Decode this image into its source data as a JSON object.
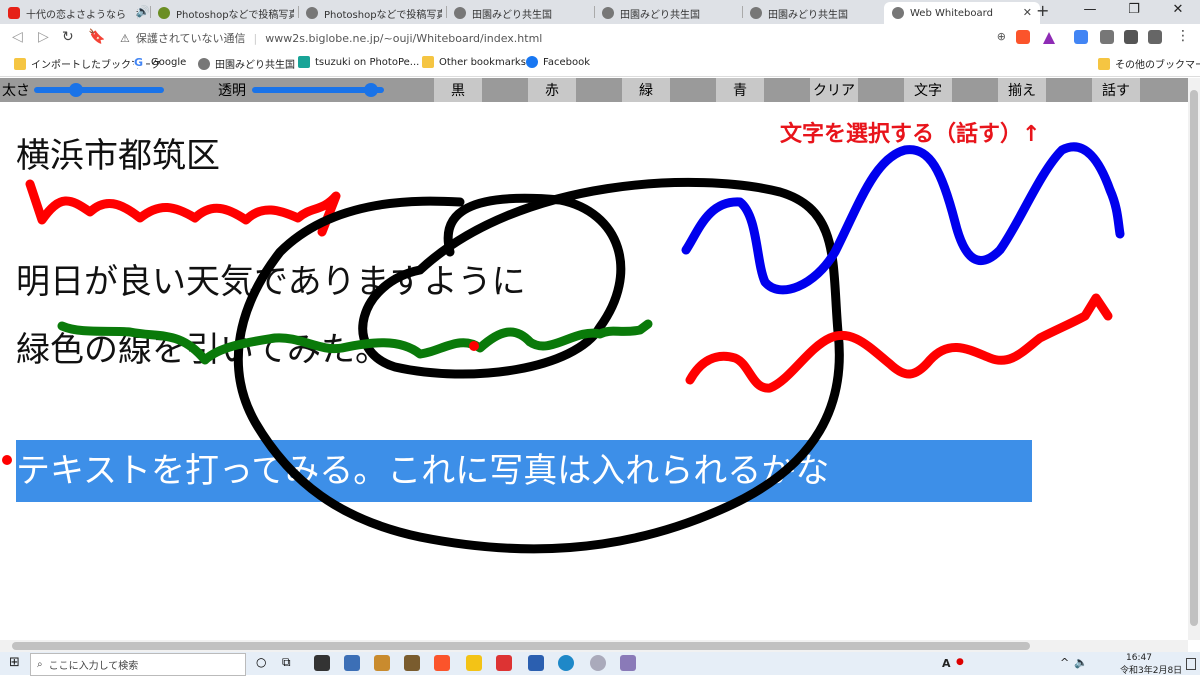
{
  "browser": {
    "tabs": [
      {
        "title": "十代の恋よさようなら　神…",
        "icon": "youtube-icon"
      },
      {
        "title": "Photoshopなどで投稿写真や…",
        "icon": "photo-icon"
      },
      {
        "title": "Photoshopなどで投稿写真や…",
        "icon": "globe-icon"
      },
      {
        "title": "田園みどり共生国",
        "icon": "globe-icon"
      },
      {
        "title": "田園みどり共生国",
        "icon": "globe-icon"
      },
      {
        "title": "田園みどり共生国",
        "icon": "globe-icon"
      },
      {
        "title": "Web Whiteboard",
        "icon": "globe-icon",
        "active": true
      }
    ],
    "security_label": "保護されていない通信",
    "url": "www2s.biglobe.ne.jp/~ouji/Whiteboard/index.html",
    "bookmarks": [
      {
        "label": "インポートしたブックマーク"
      },
      {
        "label": "Google"
      },
      {
        "label": "田園みどり共生国"
      },
      {
        "label": "tsuzuki on PhotoPe..."
      },
      {
        "label": "Other bookmarks"
      },
      {
        "label": "Facebook"
      }
    ],
    "other_bookmarks": "その他のブックマーク"
  },
  "whiteboard": {
    "thickness_label": "太さ",
    "opacity_label": "透明",
    "thickness_value": 0.3,
    "opacity_value": 0.95,
    "buttons": [
      "黒",
      "赤",
      "緑",
      "青",
      "クリア",
      "文字",
      "揃え",
      "話す"
    ],
    "texts": {
      "location": "横浜市都筑区",
      "wish": "明日が良い天気でありますように",
      "green_line": "緑色の線を引いてみた。",
      "selected": "テキストを打ってみる。これに写真は入れられるかな"
    },
    "hint": "文字を選択する（話す）↑",
    "colors": {
      "black": "#000000",
      "red": "#ff0000",
      "green": "#0a7a0a",
      "blue": "#0000ee",
      "selection": "#3d8fe8",
      "toolbar": "#9a9a9a"
    }
  },
  "taskbar": {
    "search_placeholder": "ここに入力して検索",
    "time": "16:47",
    "date": "令和3年2月8日",
    "ime": "A"
  }
}
